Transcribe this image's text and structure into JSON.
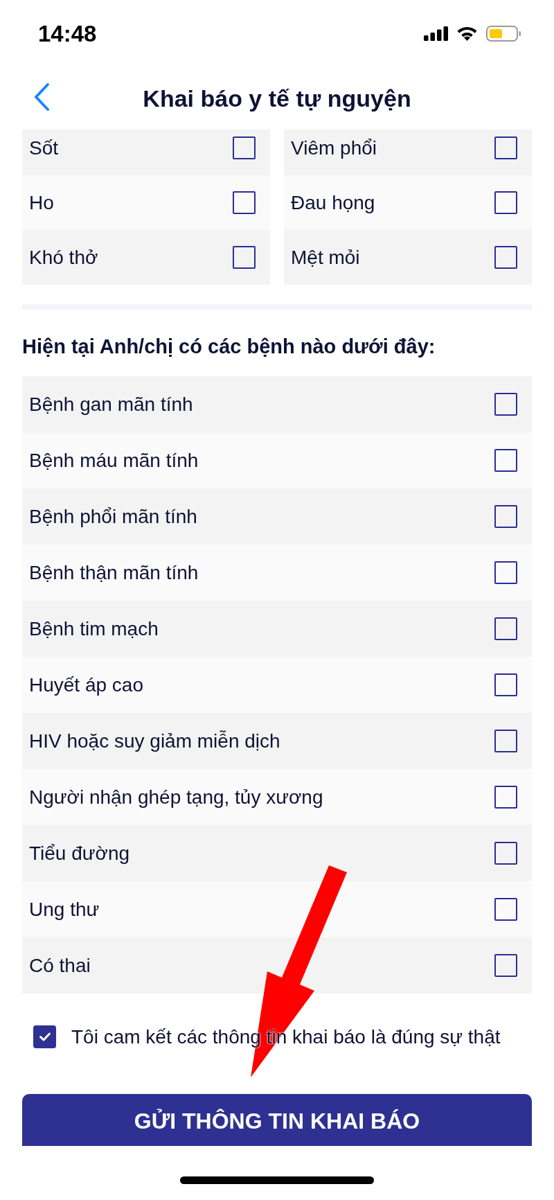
{
  "status_bar": {
    "time": "14:48"
  },
  "header": {
    "title": "Khai báo y tế tự nguyện"
  },
  "symptoms": {
    "groups": [
      {
        "items": [
          {
            "label": "Sốt",
            "checked": false
          },
          {
            "label": "Ho",
            "checked": false
          },
          {
            "label": "Khó thở",
            "checked": false
          }
        ]
      },
      {
        "items": [
          {
            "label": "Viêm phổi",
            "checked": false
          },
          {
            "label": "Đau họng",
            "checked": false
          },
          {
            "label": "Mệt mỏi",
            "checked": false
          }
        ]
      }
    ]
  },
  "conditions": {
    "heading": "Hiện tại Anh/chị có các bệnh nào dưới đây:",
    "items": [
      {
        "label": "Bệnh gan mãn tính",
        "checked": false
      },
      {
        "label": "Bệnh máu mãn tính",
        "checked": false
      },
      {
        "label": "Bệnh phổi mãn tính",
        "checked": false
      },
      {
        "label": "Bệnh thận mãn tính",
        "checked": false
      },
      {
        "label": "Bệnh tim mạch",
        "checked": false
      },
      {
        "label": "Huyết áp cao",
        "checked": false
      },
      {
        "label": "HIV hoặc suy giảm miễn dịch",
        "checked": false
      },
      {
        "label": "Người nhận ghép tạng, tủy xương",
        "checked": false
      },
      {
        "label": "Tiểu đường",
        "checked": false
      },
      {
        "label": "Ung thư",
        "checked": false
      },
      {
        "label": "Có thai",
        "checked": false
      }
    ]
  },
  "commitment": {
    "label": "Tôi cam kết các thông tin khai báo là đúng sự thật",
    "checked": true
  },
  "submit_button": {
    "label": "GỬI THÔNG TIN KHAI BÁO"
  },
  "annotation": {
    "kind": "arrow"
  }
}
